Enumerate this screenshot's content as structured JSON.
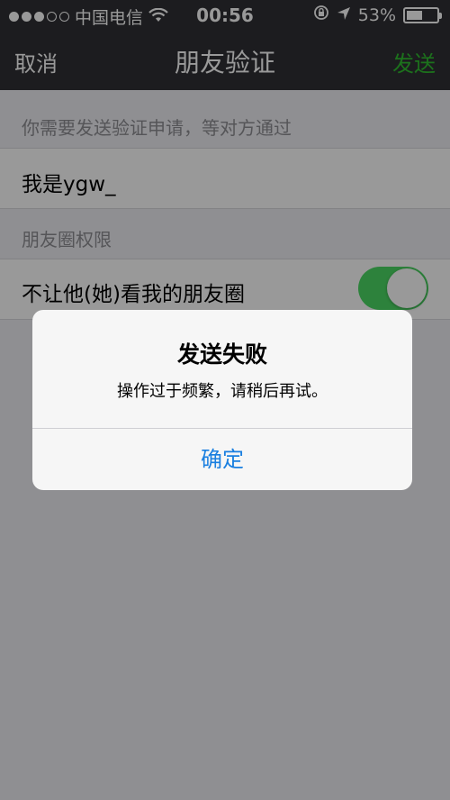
{
  "status_bar": {
    "signal_dots": 5,
    "signal_dots_filled": 3,
    "carrier": "中国电信",
    "wifi_icon": "wifi-icon",
    "time": "00:56",
    "lock_icon": "rotation-lock-icon",
    "location_icon": "location-arrow-icon",
    "battery_percent": "53%",
    "battery_level": 0.53
  },
  "nav": {
    "cancel_label": "取消",
    "title": "朋友验证",
    "send_label": "发送"
  },
  "form": {
    "hint": "你需要发送验证申请，等对方通过",
    "message_value": "我是ygw_",
    "section_label": "朋友圈权限",
    "switch_label": "不让他(她)看我的朋友圈",
    "switch_on": true
  },
  "alert": {
    "title": "发送失败",
    "message": "操作过于频繁，请稍后再试。",
    "button_label": "确定"
  },
  "colors": {
    "nav_bg": "#2f3034",
    "send_green": "#2fbd2f",
    "switch_green": "#4cd964",
    "alert_button_blue": "#1a7fe0"
  }
}
